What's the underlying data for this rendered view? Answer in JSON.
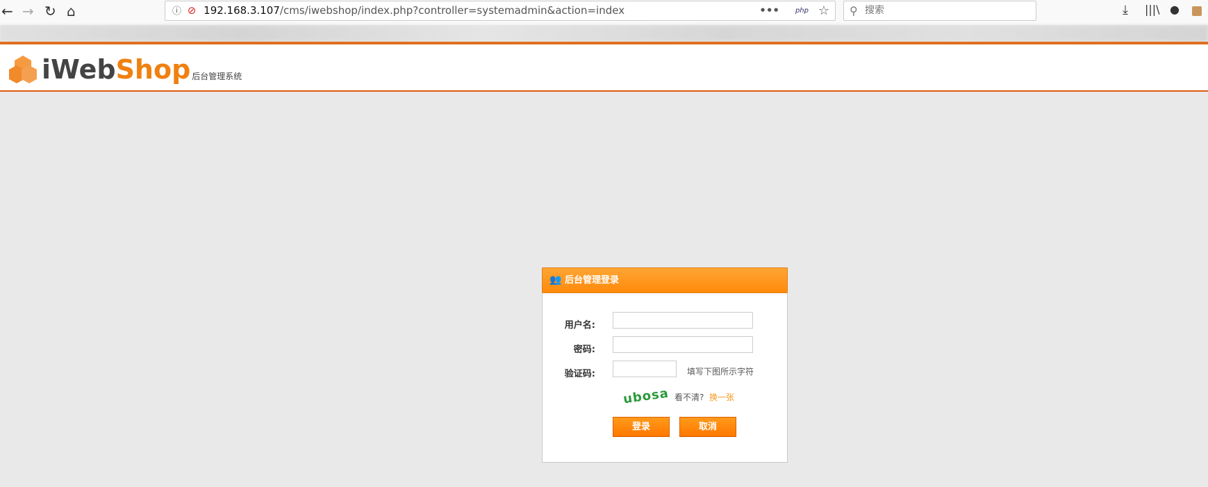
{
  "browser": {
    "url_host": "192.168.3.107",
    "url_path": "/cms/iwebshop/index.php?controller=systemadmin&action=index",
    "search_placeholder": "搜索",
    "php_badge": "php"
  },
  "header": {
    "logo_part1": "iWeb",
    "logo_part2": "Shop",
    "subtitle": "后台管理系统"
  },
  "login": {
    "title": "后台管理登录",
    "username_label": "用户名:",
    "username_value": "",
    "password_label": "密码:",
    "password_value": "",
    "captcha_label": "验证码:",
    "captcha_value": "",
    "captcha_hint": "填写下图所示字符",
    "captcha_text": "ubosa",
    "unclear_text": "看不清?",
    "refresh_link": "换一张",
    "submit_label": "登录",
    "cancel_label": "取消"
  },
  "colors": {
    "accent": "#ff8a0a",
    "header_line": "#e07020",
    "captcha_green": "#2a9a3a"
  }
}
